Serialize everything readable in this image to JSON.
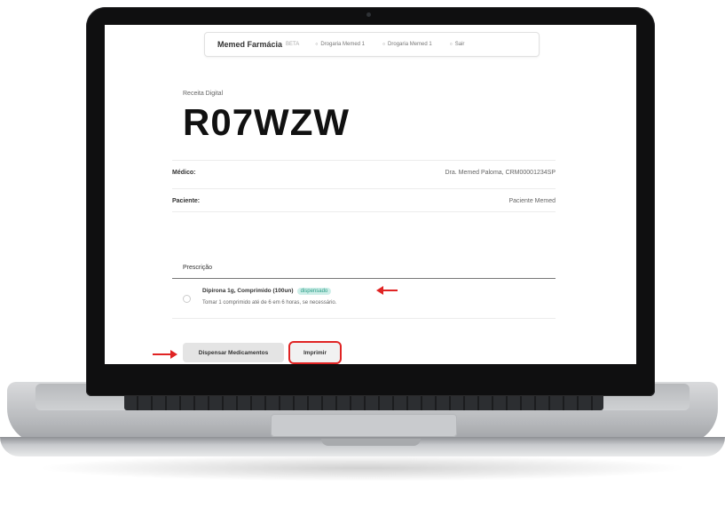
{
  "app": {
    "brand": "Memed Farmácia",
    "beta": "BETA",
    "nav": [
      "Drogaria Memed 1",
      "Drogaria Memed 1",
      "Sair"
    ]
  },
  "prescription": {
    "label": "Receita Digital",
    "code": "R07WZW",
    "doctor_label": "Médico:",
    "doctor_value": "Dra. Memed Paloma, CRM00001234SP",
    "patient_label": "Paciente:",
    "patient_value": "Paciente Memed",
    "section_label": "Prescrição",
    "item_name": "Dipirona 1g, Comprimido (100un)",
    "item_badge": "dispensado",
    "item_desc": "Tomar 1 comprimido até de 6 em 6 horas, se necessário."
  },
  "actions": {
    "dispense": "Dispensar Medicamentos",
    "print": "Imprimir"
  },
  "colors": {
    "accent": "#e02424",
    "badge_bg": "#cdeee8",
    "badge_text": "#2a9d86"
  }
}
